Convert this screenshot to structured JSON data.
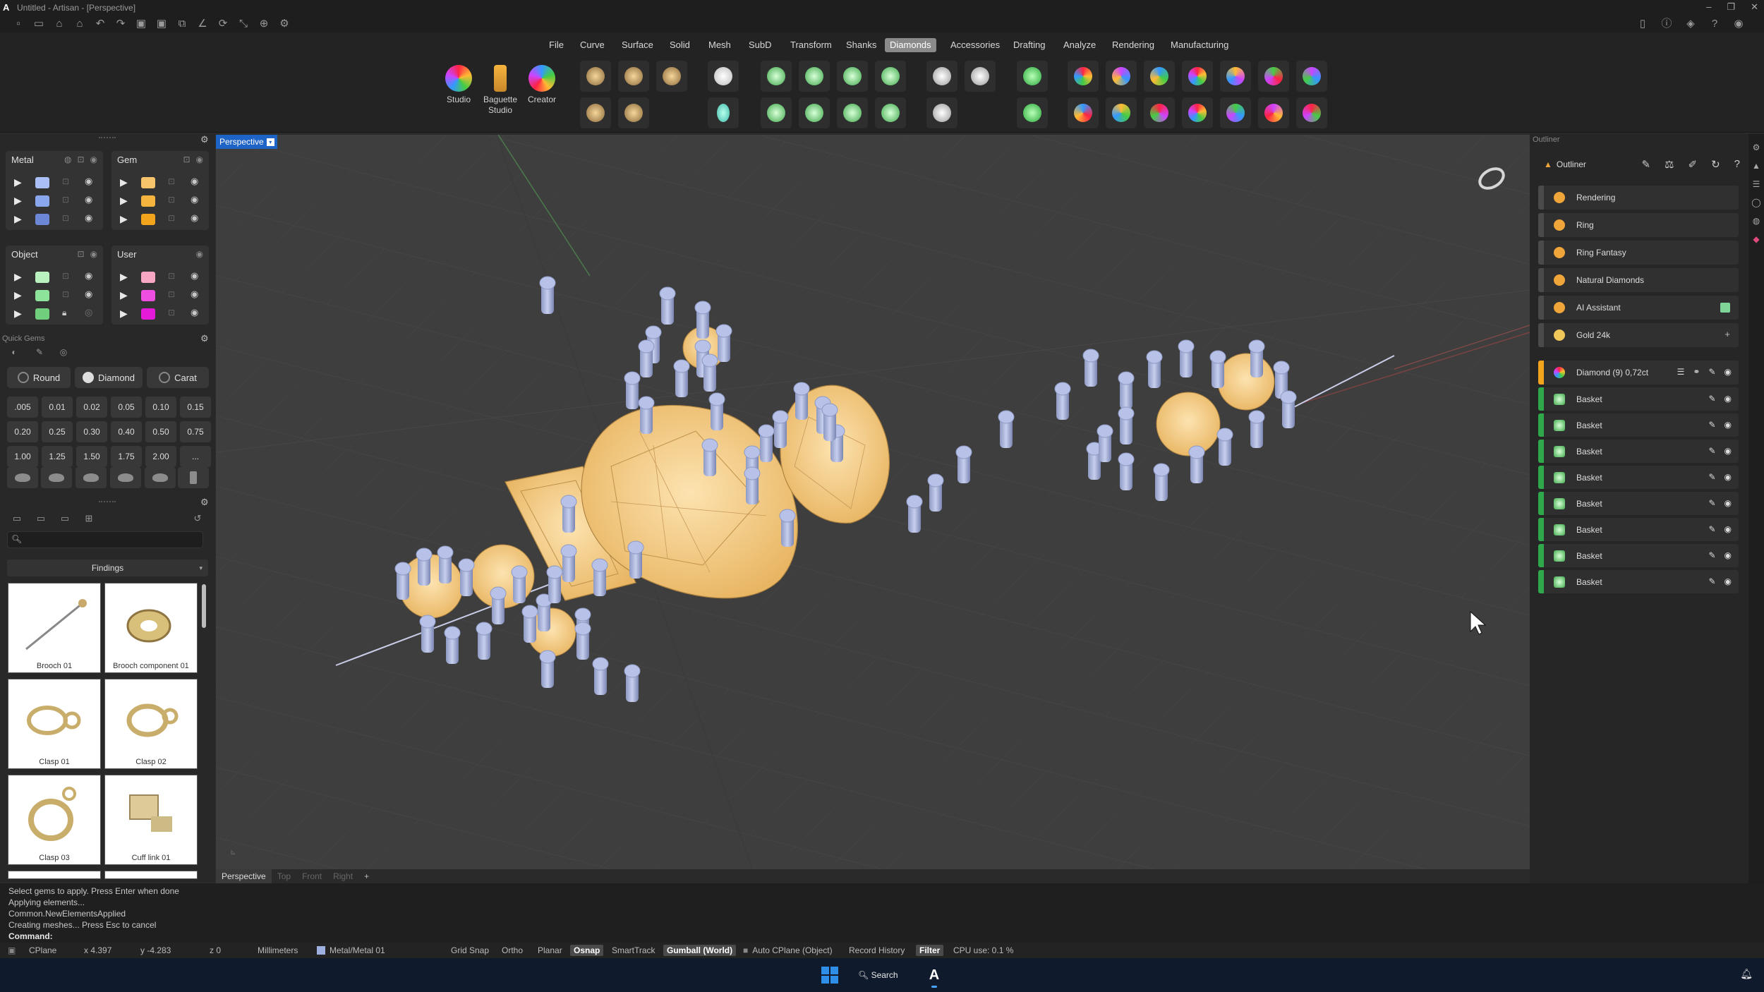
{
  "window": {
    "title": "Untitled - Artisan - [Perspective]",
    "logo": "A"
  },
  "menu": {
    "items": [
      "File",
      "Curve",
      "Surface",
      "Solid",
      "Mesh",
      "SubD",
      "Transform",
      "Shanks",
      "Diamonds",
      "Accessories",
      "Drafting",
      "Analyze",
      "Rendering",
      "Manufacturing"
    ],
    "active": "Diamonds"
  },
  "ribbon": {
    "studio": "Studio",
    "baguette_1": "Baguette",
    "baguette_2": "Studio",
    "creator": "Creator"
  },
  "layers": {
    "metal": {
      "title": "Metal",
      "swatches": [
        "#a9bff5",
        "#8aa6ec",
        "#6c87d6"
      ]
    },
    "gem": {
      "title": "Gem",
      "swatches": [
        "#f7c46b",
        "#f5b43e",
        "#f2a51c"
      ]
    },
    "object": {
      "title": "Object",
      "swatches": [
        "#b9f2bf",
        "#8ee39a",
        "#6fcf7d"
      ]
    },
    "user": {
      "title": "User",
      "swatches": [
        "#f7a6c3",
        "#ee4fe0",
        "#e31bd8"
      ]
    }
  },
  "quick_gems": {
    "label": "Quick Gems",
    "shape_btn": "Round",
    "material_btn": "Diamond",
    "unit_btn": "Carat",
    "carats": [
      ".005",
      "0.01",
      "0.02",
      "0.05",
      "0.10",
      "0.15",
      "0.20",
      "0.25",
      "0.30",
      "0.40",
      "0.50",
      "0.75",
      "1.00",
      "1.25",
      "1.50",
      "1.75",
      "2.00",
      "..."
    ]
  },
  "library": {
    "search_placeholder": "",
    "category": "Findings",
    "items": [
      "Brooch 01",
      "Brooch component 01",
      "Clasp 01",
      "Clasp 02",
      "Clasp 03",
      "Cuff link 01"
    ]
  },
  "viewport": {
    "name": "Perspective",
    "tabs": [
      "Perspective",
      "Top",
      "Front",
      "Right",
      "+"
    ]
  },
  "outliner": {
    "panel_title": "Outliner",
    "title": "Outliner",
    "presets": [
      {
        "name": "Rendering",
        "color": "#f0a53a"
      },
      {
        "name": "Ring",
        "color": "#f0a53a"
      },
      {
        "name": "Ring Fantasy",
        "color": "#f0a53a"
      },
      {
        "name": "Natural Diamonds",
        "color": "#f0a53a"
      },
      {
        "name": "AI Assistant",
        "color": "#f0a53a"
      },
      {
        "name": "Gold 24k",
        "color": "#f0c85a"
      }
    ],
    "group": "Diamond (9) 0,72ct",
    "baskets": [
      "Basket",
      "Basket",
      "Basket",
      "Basket",
      "Basket",
      "Basket",
      "Basket",
      "Basket"
    ]
  },
  "command": {
    "history": [
      "Select gems to apply. Press Enter when done",
      "Applying elements...",
      "Common.NewElementsApplied",
      "Creating meshes... Press Esc to cancel"
    ],
    "prompt": "Command:"
  },
  "status": {
    "cplane": "CPlane",
    "x": "x 4.397",
    "y": "y -4.283",
    "z": "z 0",
    "units": "Millimeters",
    "layer": "Metal/Metal 01",
    "grid_snap": "Grid Snap",
    "ortho": "Ortho",
    "planar": "Planar",
    "osnap": "Osnap",
    "smarttrack": "SmartTrack",
    "gumball": "Gumball (World)",
    "auto_cplane": "Auto CPlane (Object)",
    "record_history": "Record History",
    "filter": "Filter",
    "cpu": "CPU use: 0.1 %"
  },
  "taskbar": {
    "search": "Search"
  }
}
